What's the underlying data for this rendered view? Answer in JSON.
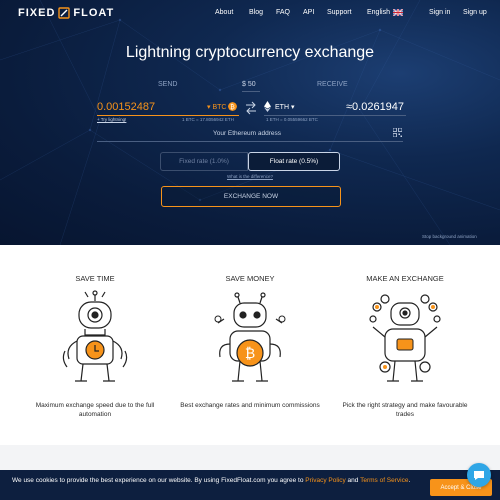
{
  "brand": {
    "word1": "FIXED",
    "word2": "FLOAT"
  },
  "nav": {
    "about": "About",
    "blog": "Blog",
    "faq": "FAQ",
    "api": "API",
    "support": "Support",
    "language": "English",
    "sign_in": "Sign in",
    "sign_up": "Sign up"
  },
  "hero": {
    "title": "Lightning cryptocurrency exchange",
    "send_label": "SEND",
    "receive_label": "RECEIVE",
    "usd_value": "$ 50",
    "send_amount": "0.00152487",
    "send_currency": "BTC",
    "receive_amount": "≈0.0261947",
    "receive_currency": "ETH",
    "try_lightning": "+ Try lightning!",
    "send_rate_note": "1 BTC = 17.8056942 ETH",
    "receive_rate_note": "1 ETH = 0.05559662 BTC",
    "address_placeholder": "Your Ethereum address",
    "fixed_rate": "Fixed rate (1.0%)",
    "float_rate": "Float rate (0.5%)",
    "difference_link": "What is the difference?",
    "exchange_button": "EXCHANGE NOW",
    "stop_animation": "Stop background animation"
  },
  "features": [
    {
      "title": "SAVE TIME",
      "desc": "Maximum exchange speed due to the full automation"
    },
    {
      "title": "SAVE MONEY",
      "desc": "Best exchange rates and minimum commissions"
    },
    {
      "title": "MAKE AN EXCHANGE",
      "desc": "Pick the right strategy and make favourable trades"
    }
  ],
  "cookie": {
    "text_before": "We use cookies to provide the best experience on our website. By using FixedFloat.com you agree to ",
    "privacy": "Privacy Policy",
    "and": " and ",
    "terms": "Terms of Service",
    "end": ".",
    "accept": "Accept & Close"
  },
  "colors": {
    "accent": "#f7931a",
    "hero_bg": "#0f2850",
    "cookie_bg": "#0d1f3f",
    "chat": "#2fa6e6"
  },
  "icons": [
    "logo-mark-icon",
    "uk-flag-icon",
    "bitcoin-coin-icon",
    "ethereum-icon",
    "swap-arrows-icon",
    "qr-code-icon",
    "robot-clock-illustration",
    "robot-bitcoin-illustration",
    "robot-juggler-illustration",
    "chat-bubble-icon"
  ]
}
